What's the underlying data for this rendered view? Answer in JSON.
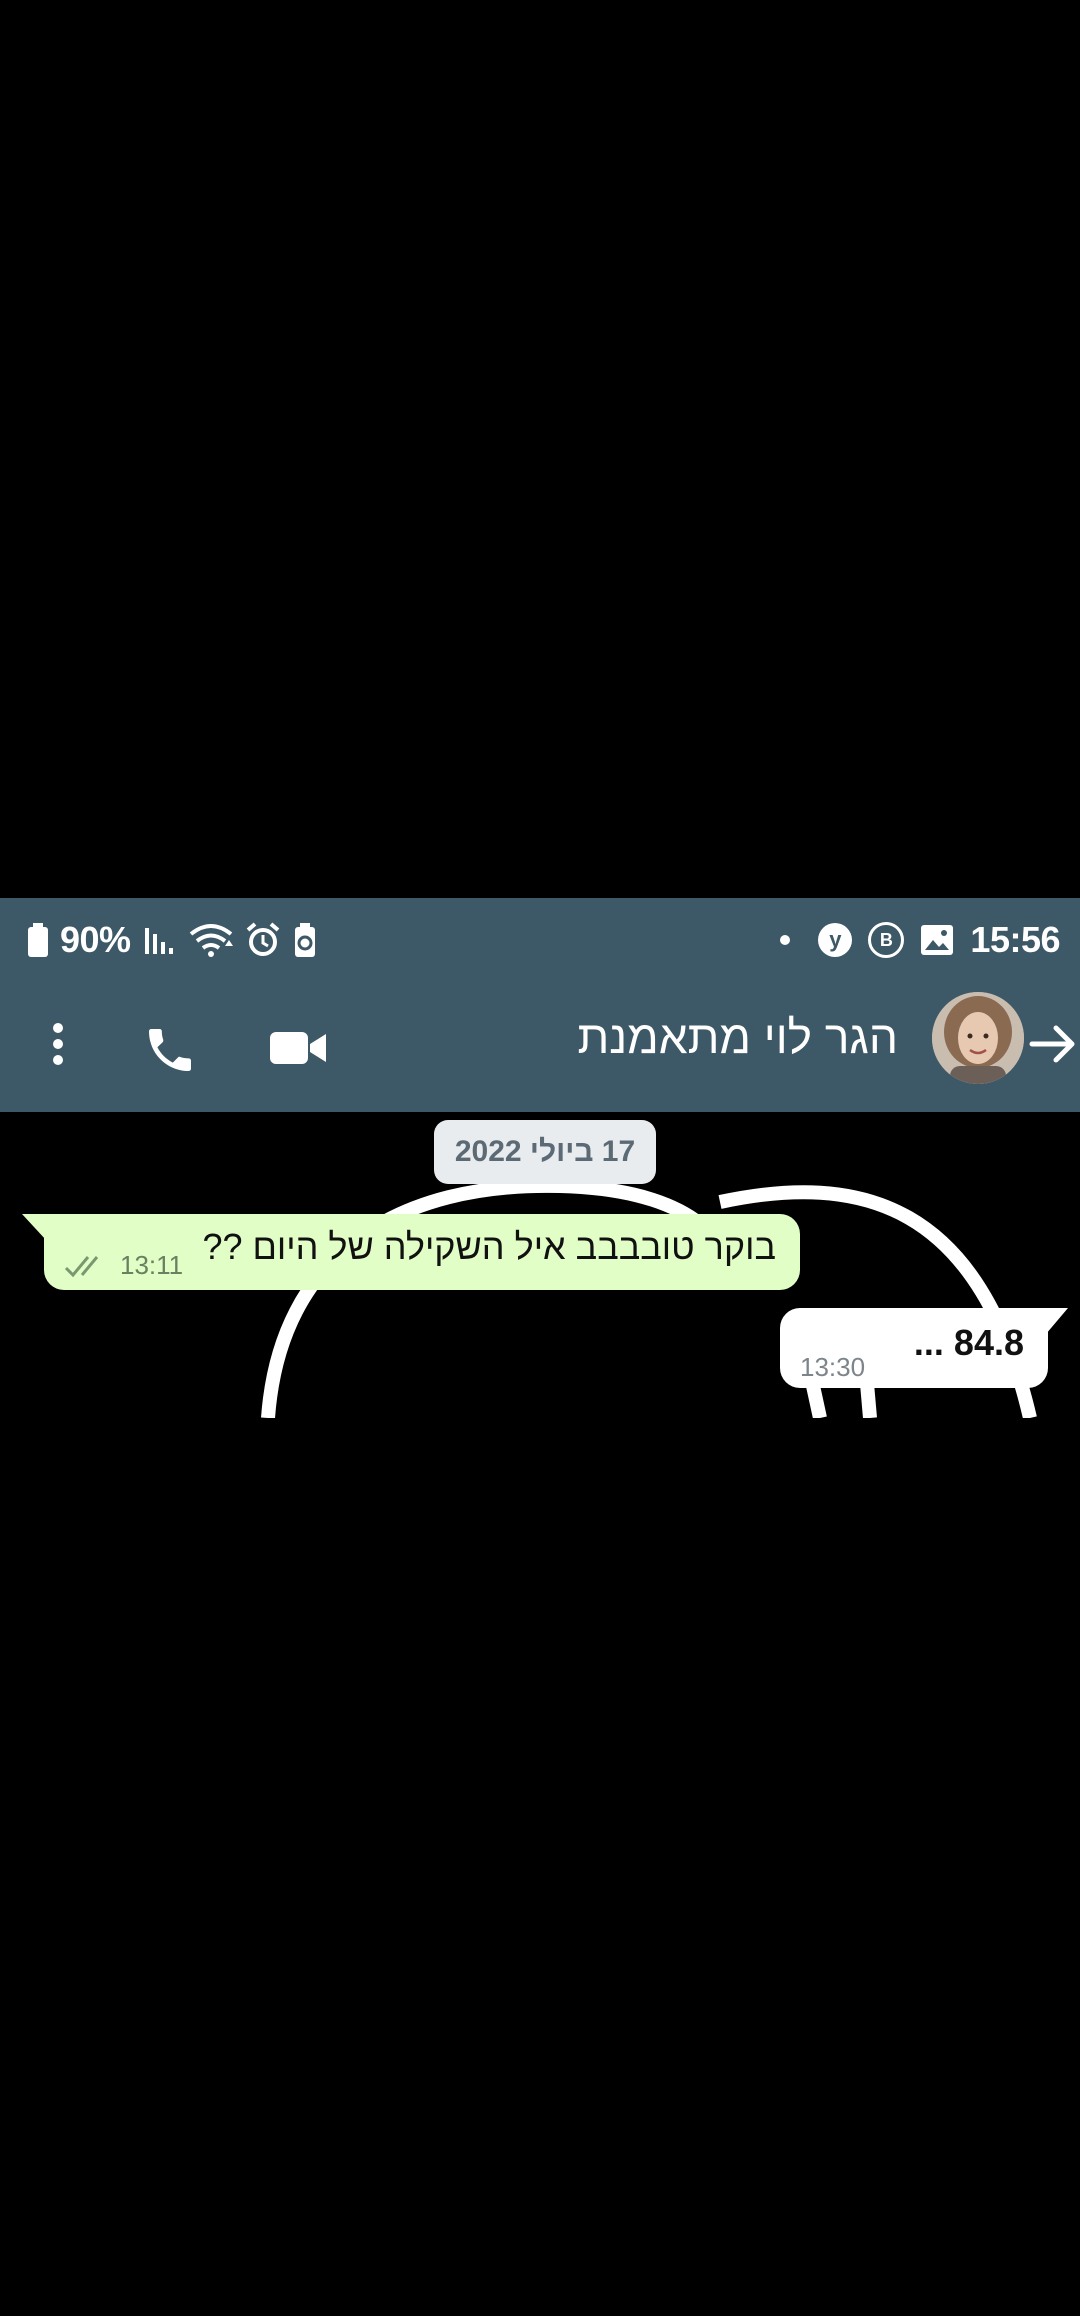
{
  "status_bar": {
    "battery": "90%",
    "time": "15:56",
    "icons": [
      "battery-icon",
      "signal-icon",
      "wifi-icon",
      "alarm-icon",
      "battery-saver-icon",
      "notification-dot-icon",
      "yahoo-icon",
      "b-app-icon",
      "gallery-icon"
    ],
    "badge_y": "y",
    "badge_b": "B"
  },
  "header": {
    "contact_name": "הגר לוי מתאמנת",
    "icons": [
      "back-arrow-icon",
      "avatar",
      "video-call-icon",
      "phone-call-icon",
      "more-options-icon"
    ]
  },
  "chat": {
    "date_chip": "17 ביולי 2022",
    "messages": [
      {
        "direction": "outgoing",
        "text": "בוקר טובבבב איל השקילה של היום ??",
        "time": "13:11",
        "status": "read"
      },
      {
        "direction": "incoming",
        "text": "84.8 ...",
        "time": "13:30"
      }
    ]
  },
  "colors": {
    "header_bg": "#3d5866",
    "outgoing_bubble": "#e1fec6",
    "incoming_bubble": "#ffffff",
    "date_chip_bg": "#e9ecef",
    "chat_bg": "#000000"
  }
}
